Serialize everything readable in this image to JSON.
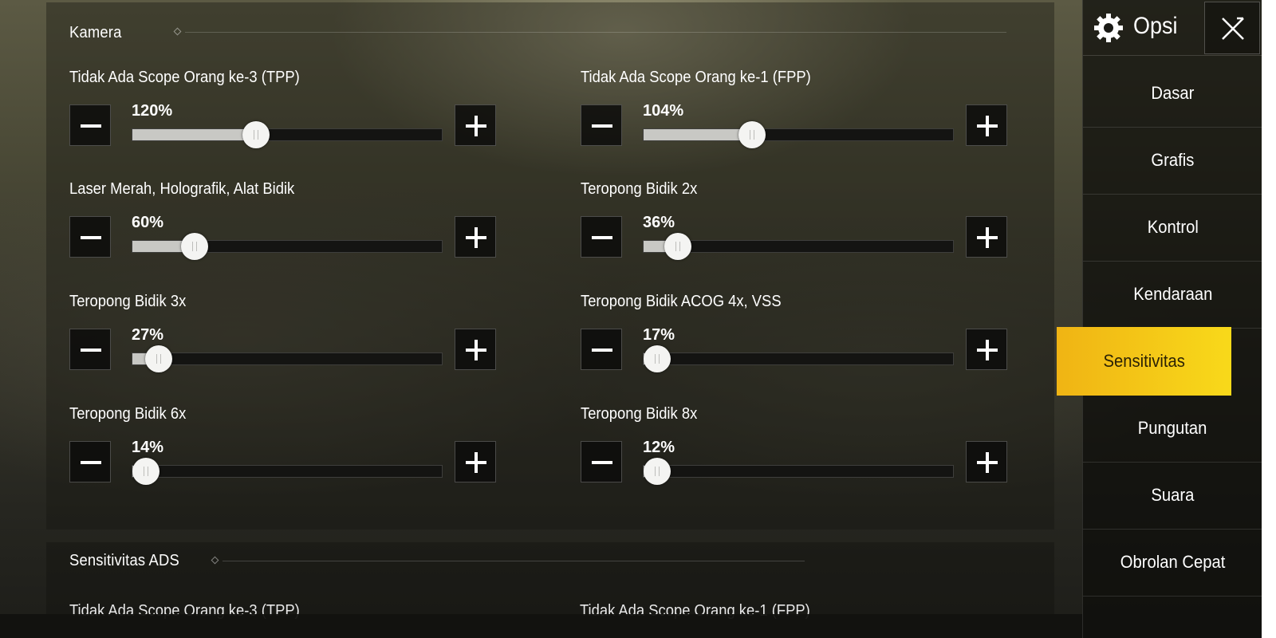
{
  "sidebar": {
    "title": "Opsi",
    "items": [
      {
        "label": "Dasar"
      },
      {
        "label": "Grafis"
      },
      {
        "label": "Kontrol"
      },
      {
        "label": "Kendaraan"
      },
      {
        "label": "Sensitivitas",
        "active": true
      },
      {
        "label": "Pungutan"
      },
      {
        "label": "Suara"
      },
      {
        "label": "Obrolan Cepat"
      }
    ]
  },
  "camera": {
    "title": "Kamera",
    "rows": [
      {
        "label": "Tidak Ada Scope Orang ke-3 (TPP)",
        "value_label": "120%",
        "level": 0.4
      },
      {
        "label": "Tidak Ada Scope Orang ke-1 (FPP)",
        "value_label": "104%",
        "level": 0.35
      },
      {
        "label": "Laser Merah, Holografik, Alat Bidik",
        "value_label": "60%",
        "level": 0.2
      },
      {
        "label": "Teropong Bidik 2x",
        "value_label": "36%",
        "level": 0.11
      },
      {
        "label": "Teropong Bidik 3x",
        "value_label": "27%",
        "level": 0.085
      },
      {
        "label": "Teropong Bidik ACOG 4x, VSS",
        "value_label": "17%",
        "level": 0.045
      },
      {
        "label": "Teropong Bidik 6x",
        "value_label": "14%",
        "level": 0.04
      },
      {
        "label": "Teropong Bidik 8x",
        "value_label": "12%",
        "level": 0.035
      }
    ]
  },
  "ads": {
    "title": "Sensitivitas ADS",
    "partial_labels": [
      "Tidak Ada Scope Orang ke-3 (TPP)",
      "Tidak Ada Scope Orang ke-1 (FPP)"
    ]
  },
  "colors": {
    "accent_start": "#f0b414",
    "accent_end": "#f8d91a"
  }
}
